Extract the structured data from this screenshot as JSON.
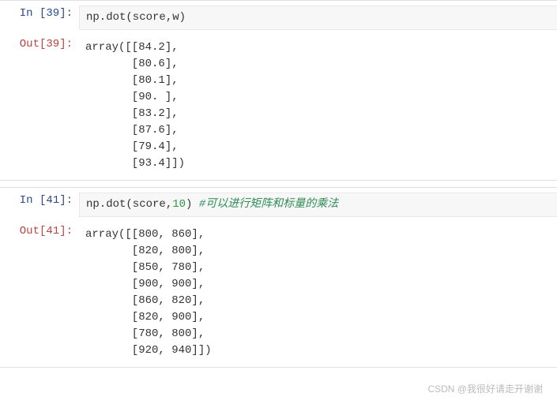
{
  "cells": [
    {
      "in_number": 39,
      "in_prompt": "In  [39]:",
      "out_prompt": "Out[39]:",
      "code_plain": "np.dot(score,w)",
      "output": "array([[84.2],\n       [80.6],\n       [80.1],\n       [90. ],\n       [83.2],\n       [87.6],\n       [79.4],\n       [93.4]])"
    },
    {
      "in_number": 41,
      "in_prompt": "In  [41]:",
      "out_prompt": "Out[41]:",
      "code_plain": "np.dot(score,10)",
      "code_arg": "10",
      "comment": " #可以进行矩阵和标量的乘法",
      "output": "array([[800, 860],\n       [820, 800],\n       [850, 780],\n       [900, 900],\n       [860, 820],\n       [820, 900],\n       [780, 800],\n       [920, 940]])"
    }
  ],
  "watermark": "CSDN @我很好请走开谢谢"
}
